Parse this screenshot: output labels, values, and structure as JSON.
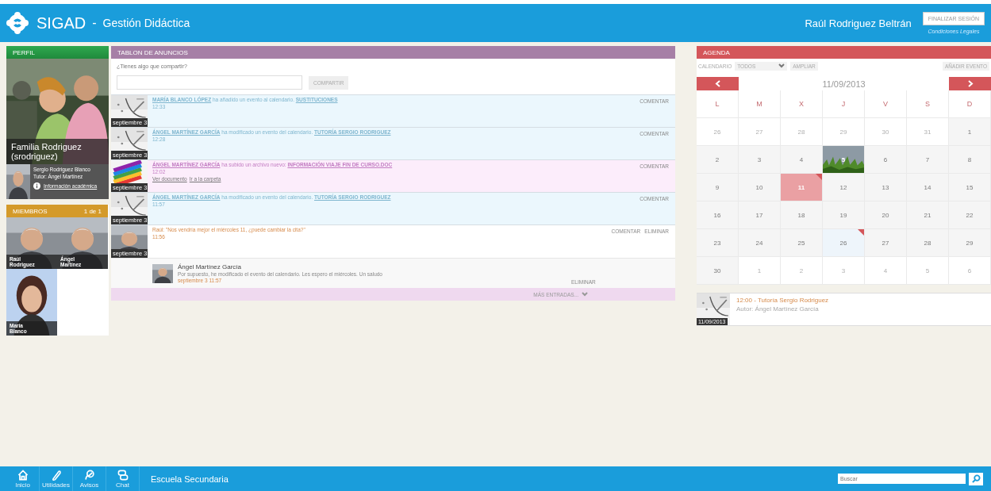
{
  "header": {
    "logo_text": "SIGAD",
    "separator": "-",
    "subtitle": "Gestión Didáctica",
    "user": "Raúl Rodriguez Beltrán",
    "logout_button": "FINALIZAR SESIÓN",
    "legal_link": "Condiciones Legales"
  },
  "profile": {
    "title": "PERFIL",
    "name": "Familia Rodriguez",
    "username": "(srodriguez)",
    "student": "Sergio Rodriguez Blanco",
    "tutor": "Tutor: Ángel Martínez",
    "info_link": "Información académica"
  },
  "members": {
    "title": "MIEMBROS",
    "page": "1 de 1",
    "items": [
      {
        "first": "Raúl",
        "last": "Rodriguez"
      },
      {
        "first": "Ángel",
        "last": "Martínez"
      },
      {
        "first": "María",
        "last": "Blanco"
      }
    ]
  },
  "board": {
    "title": "TABLON DE ANUNCIOS",
    "prompt": "¿Tienes algo que compartir?",
    "share_button": "COMPARTIR",
    "more": "MÁS ENTRADAS...",
    "posts": [
      {
        "kind": "event",
        "date": "septiembre 3",
        "author": "MARÍA BLANCO LÓPEZ",
        "action": "ha añadido un evento al calendario.",
        "target": "SUSTITUCIONES",
        "time": "12:33",
        "actions": [
          "COMENTAR"
        ]
      },
      {
        "kind": "event",
        "date": "septiembre 3",
        "author": "ÁNGEL MARTÍNEZ GARCÍA",
        "action": "ha modificado un evento del calendario.",
        "target": "TUTORÍA SERGIO RODRIGUEZ",
        "time": "12:28",
        "actions": [
          "COMENTAR"
        ]
      },
      {
        "kind": "file",
        "date": "septiembre 3",
        "author": "ÁNGEL MARTÍNEZ GARCÍA",
        "action": "ha subido un archivo nuevo:",
        "target": "INFORMACIÓN VIAJE FIN DE CURSO.DOC",
        "time": "12:02",
        "links": [
          "Ver documento",
          "Ir a la carpeta"
        ],
        "actions": [
          "COMENTAR"
        ]
      },
      {
        "kind": "event",
        "date": "septiembre 3",
        "author": "ÁNGEL MARTÍNEZ GARCÍA",
        "action": "ha modificado un evento del calendario.",
        "target": "TUTORÍA SERGIO RODRIGUEZ",
        "time": "11:57",
        "actions": [
          "COMENTAR"
        ]
      },
      {
        "kind": "comment",
        "date": "septiembre 3",
        "text": "Raúl: \"Nos vendría mejor el miércoles 11, ¿puede cambiar la cita?\"",
        "time": "11:56",
        "actions": [
          "COMENTAR",
          "ELIMINAR"
        ],
        "replies": [
          {
            "name": "Ángel Martínez García",
            "text": "Por supuesto, he modificado el evento del calendario. Les espero el miércoles. Un saludo",
            "time": "septiembre 3 11:57",
            "action": "ELIMINAR"
          }
        ]
      }
    ]
  },
  "agenda": {
    "title": "AGENDA",
    "view_label": "CALENDARIO",
    "filter": "TODOS",
    "expand_button": "AMPLIAR",
    "add_button": "AÑADIR EVENTO",
    "date": "11/09/2013",
    "weekdays": [
      "L",
      "M",
      "X",
      "J",
      "V",
      "S",
      "D"
    ],
    "weeks": [
      [
        {
          "label": "26",
          "muted": true
        },
        {
          "label": "27",
          "muted": true
        },
        {
          "label": "28",
          "muted": true
        },
        {
          "label": "29",
          "muted": true
        },
        {
          "label": "30",
          "muted": true
        },
        {
          "label": "31",
          "muted": true
        },
        {
          "label": "1",
          "muted": false
        }
      ],
      [
        {
          "label": "2",
          "muted": false
        },
        {
          "label": "3",
          "muted": false
        },
        {
          "label": "4",
          "muted": false
        },
        {
          "label": "5",
          "muted": false,
          "kind": "picture"
        },
        {
          "label": "6",
          "muted": false
        },
        {
          "label": "7",
          "muted": false
        },
        {
          "label": "8",
          "muted": false
        }
      ],
      [
        {
          "label": "9",
          "muted": false
        },
        {
          "label": "10",
          "muted": false
        },
        {
          "label": "11",
          "muted": false,
          "selected": true,
          "event": true
        },
        {
          "label": "12",
          "muted": false
        },
        {
          "label": "13",
          "muted": false
        },
        {
          "label": "14",
          "muted": false
        },
        {
          "label": "15",
          "muted": false
        }
      ],
      [
        {
          "label": "16",
          "muted": false
        },
        {
          "label": "17",
          "muted": false
        },
        {
          "label": "18",
          "muted": false
        },
        {
          "label": "19",
          "muted": false
        },
        {
          "label": "20",
          "muted": false
        },
        {
          "label": "21",
          "muted": false
        },
        {
          "label": "22",
          "muted": false
        }
      ],
      [
        {
          "label": "23",
          "muted": false
        },
        {
          "label": "24",
          "muted": false
        },
        {
          "label": "25",
          "muted": false
        },
        {
          "label": "26",
          "muted": false,
          "kind": "tinted",
          "event": true
        },
        {
          "label": "27",
          "muted": false
        },
        {
          "label": "28",
          "muted": false
        },
        {
          "label": "29",
          "muted": false
        }
      ],
      [
        {
          "label": "30",
          "muted": false
        },
        {
          "label": "1",
          "muted": true
        },
        {
          "label": "2",
          "muted": true
        },
        {
          "label": "3",
          "muted": true
        },
        {
          "label": "4",
          "muted": true
        },
        {
          "label": "5",
          "muted": true
        },
        {
          "label": "6",
          "muted": true
        }
      ]
    ],
    "events": [
      {
        "time": "12:00",
        "title": "- Tutoría Sergio Rodriguez",
        "author": "Autor: Ángel Martínez García",
        "date": "11/09/2013"
      }
    ]
  },
  "footer": {
    "nav": [
      {
        "label": "Inicio"
      },
      {
        "label": "Utilidades"
      },
      {
        "label": "Avisos"
      },
      {
        "label": "Chat"
      }
    ],
    "school": "Escuela Secundaria",
    "search_placeholder": "Buscar"
  }
}
